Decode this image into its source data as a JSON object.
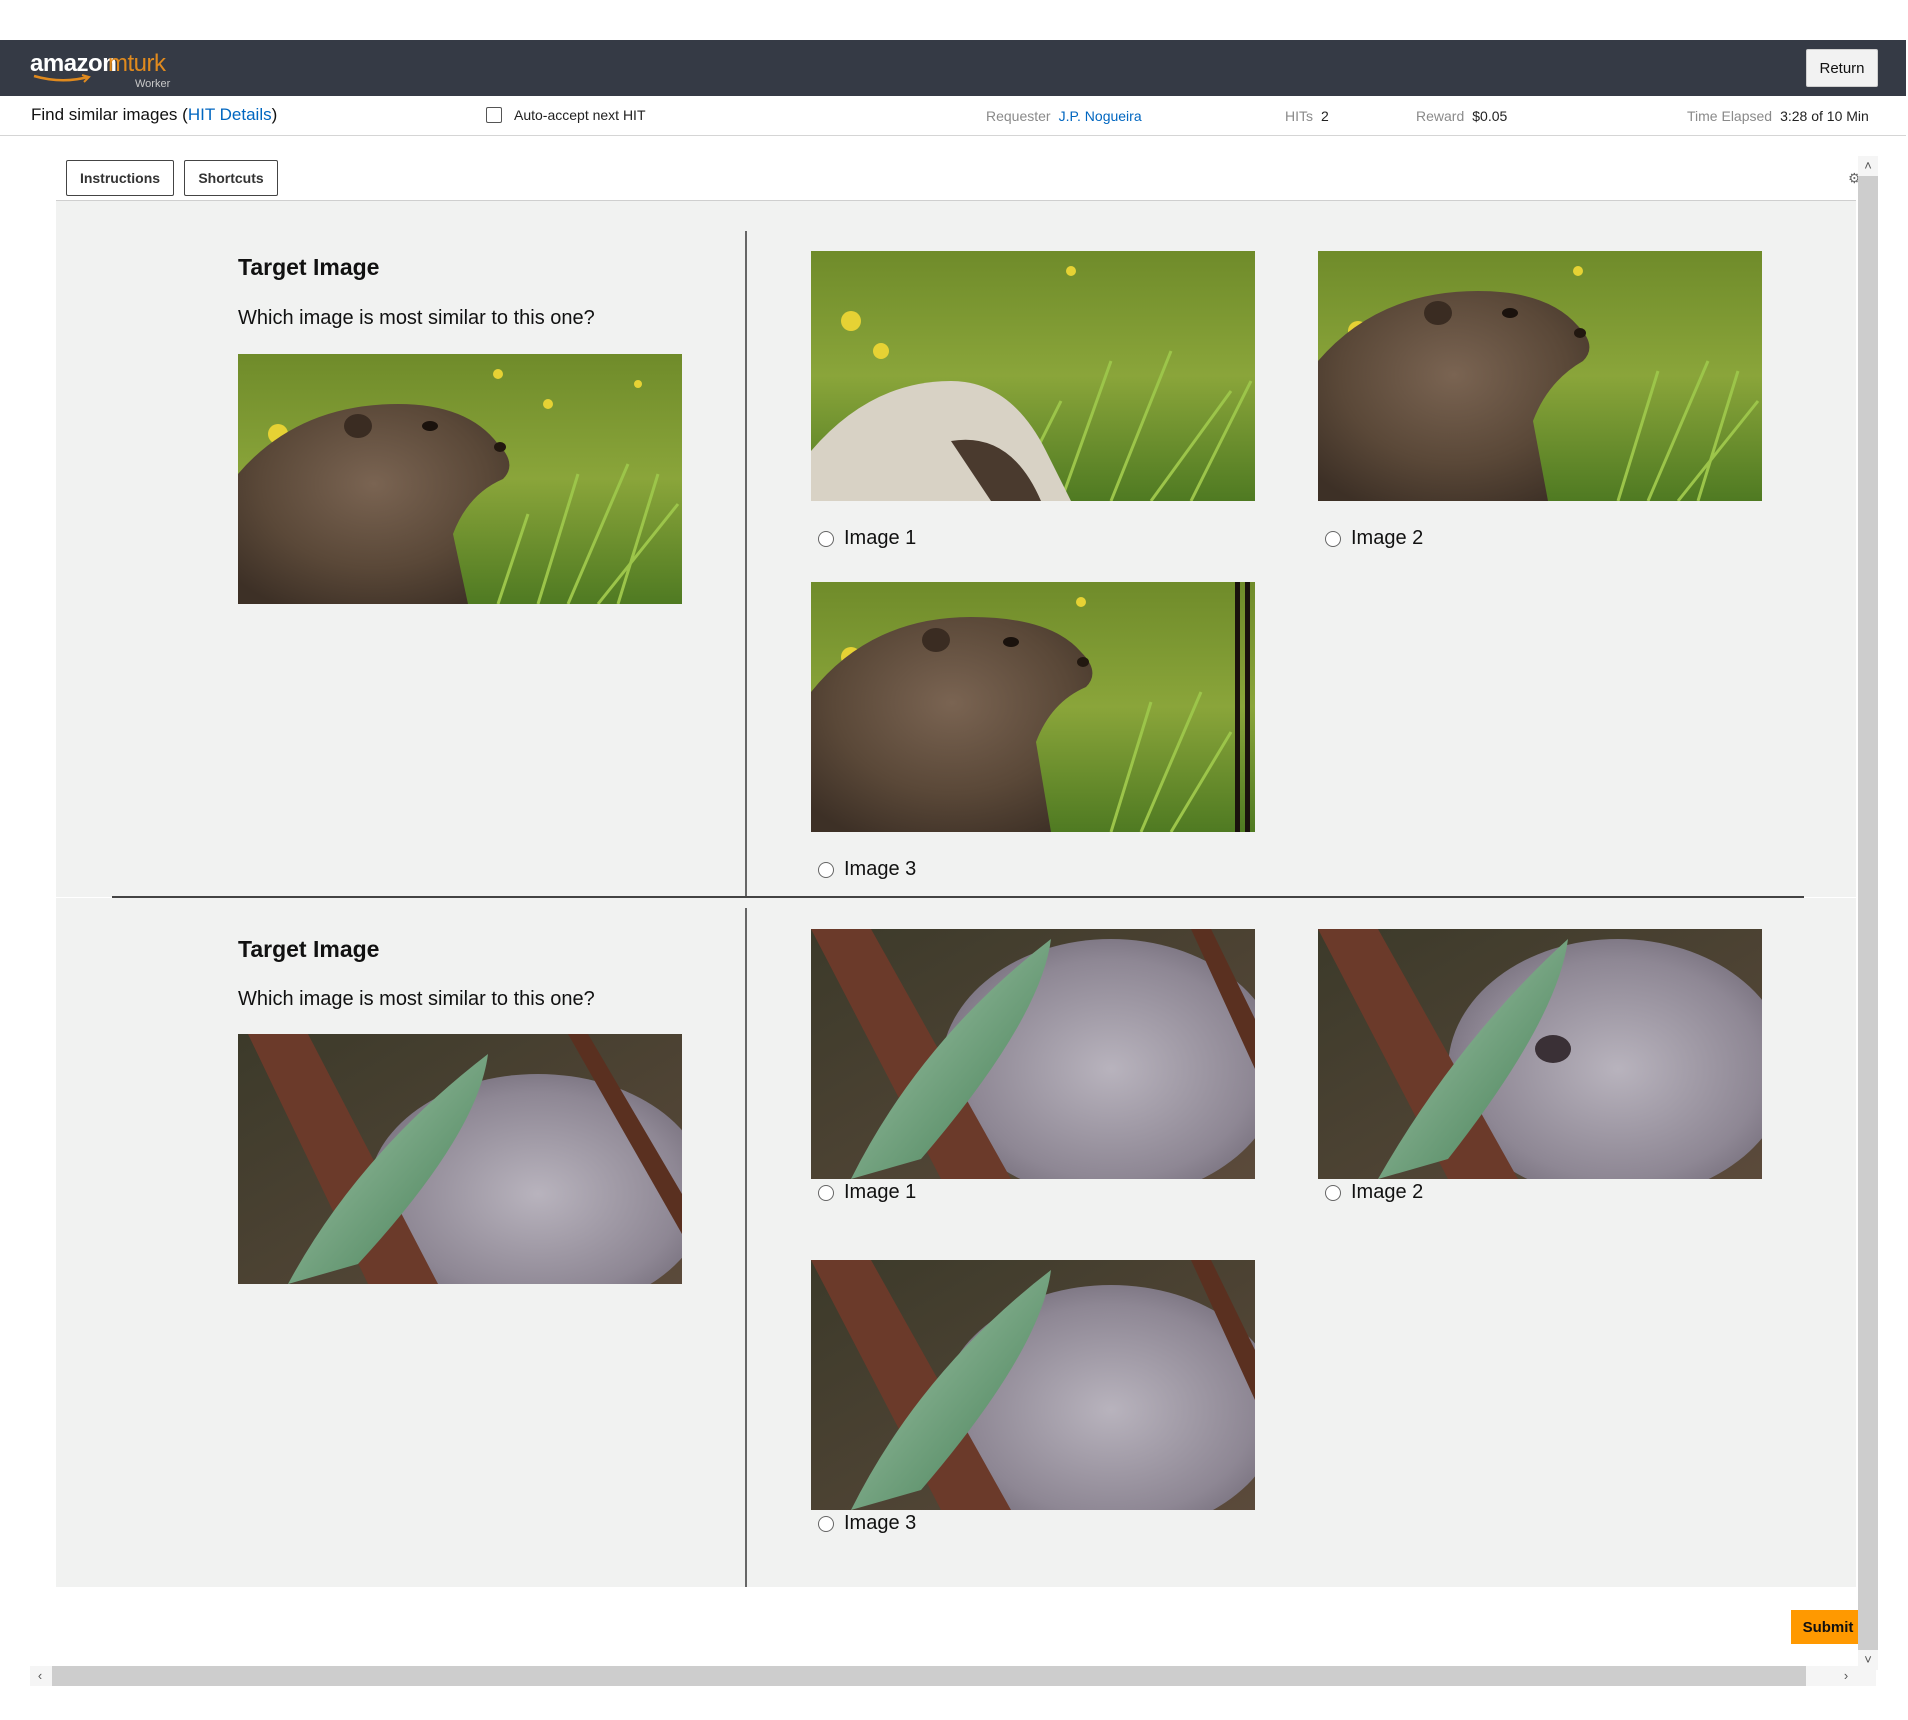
{
  "header": {
    "logo_text_amazon": "amazon",
    "logo_text_mturk": "mturk",
    "logo_text_worker": "Worker",
    "return_label": "Return"
  },
  "hit": {
    "title": "Find similar images",
    "details_link": "HIT Details",
    "auto_accept_label": "Auto-accept next HIT",
    "requester_key": "Requester",
    "requester_value": "J.P. Nogueira",
    "hits_key": "HITs",
    "hits_value": "2",
    "reward_key": "Reward",
    "reward_value": "$0.05",
    "time_key": "Time Elapsed",
    "time_value": "3:28 of 10 Min"
  },
  "tabs": {
    "instructions": "Instructions",
    "shortcuts": "Shortcuts"
  },
  "questions": [
    {
      "heading": "Target Image",
      "prompt": "Which image is most similar to this one?",
      "options": [
        "Image 1",
        "Image 2",
        "Image 3"
      ]
    },
    {
      "heading": "Target Image",
      "prompt": "Which image is most similar to this one?",
      "options": [
        "Image 1",
        "Image 2",
        "Image 3"
      ]
    }
  ],
  "submit_label": "Submit",
  "colors": {
    "topbar": "#353a45",
    "accent_orange": "#ff9900",
    "link_blue": "#0066c0",
    "panel_bg": "#f1f2f1"
  }
}
